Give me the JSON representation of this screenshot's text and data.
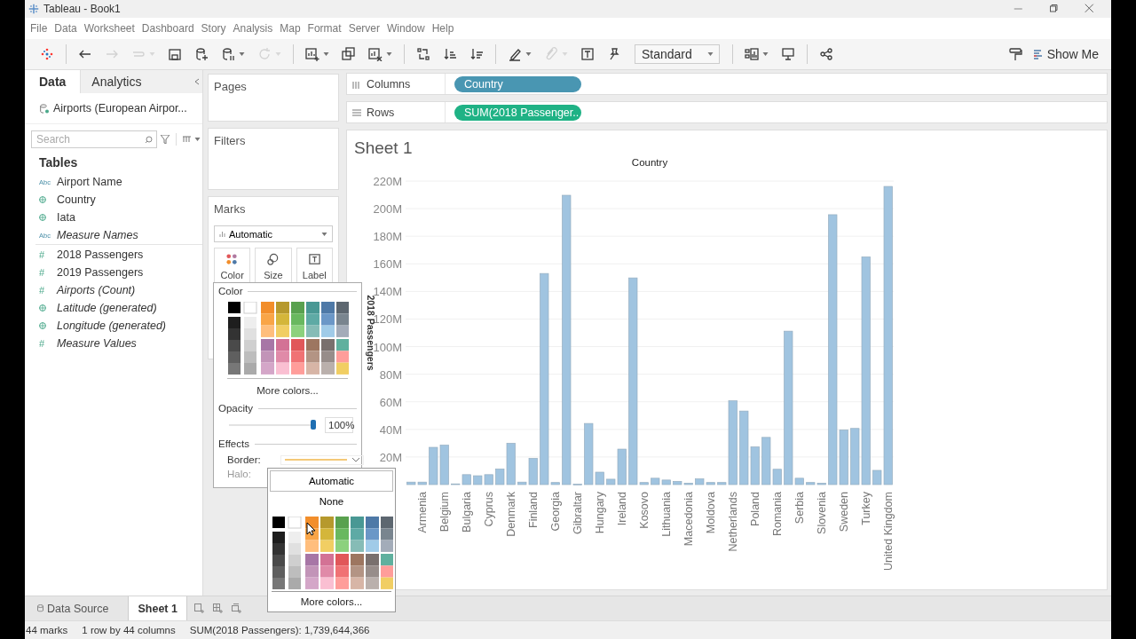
{
  "window": {
    "title": "Tableau - Book1"
  },
  "menu": [
    "File",
    "Data",
    "Worksheet",
    "Dashboard",
    "Story",
    "Analysis",
    "Map",
    "Format",
    "Server",
    "Window",
    "Help"
  ],
  "toolbar": {
    "items": [
      {
        "kind": "button",
        "disabled": false,
        "dropdown": false
      },
      {
        "kind": "separator"
      },
      {
        "kind": "button",
        "disabled": false,
        "dropdown": false
      },
      {
        "kind": "button",
        "disabled": true,
        "dropdown": false
      },
      {
        "kind": "button",
        "disabled": true,
        "dropdown": true
      },
      {
        "kind": "button",
        "disabled": false,
        "dropdown": false
      },
      {
        "kind": "button",
        "disabled": false,
        "dropdown": false
      },
      {
        "kind": "button",
        "disabled": false,
        "dropdown": true
      },
      {
        "kind": "button",
        "disabled": true,
        "dropdown": true
      },
      {
        "kind": "separator"
      },
      {
        "kind": "button",
        "disabled": false,
        "dropdown": true
      },
      {
        "kind": "button",
        "disabled": false,
        "dropdown": false
      },
      {
        "kind": "button",
        "disabled": false,
        "dropdown": true
      },
      {
        "kind": "separator"
      },
      {
        "kind": "button",
        "disabled": false,
        "dropdown": false
      },
      {
        "kind": "button",
        "disabled": false,
        "dropdown": false
      },
      {
        "kind": "button",
        "disabled": false,
        "dropdown": false
      },
      {
        "kind": "separator"
      },
      {
        "kind": "button",
        "disabled": false,
        "dropdown": true
      },
      {
        "kind": "button",
        "disabled": true,
        "dropdown": true
      },
      {
        "kind": "button",
        "disabled": false,
        "dropdown": false
      },
      {
        "kind": "button",
        "disabled": false,
        "dropdown": false
      },
      {
        "kind": "dropdown",
        "value": "Standard"
      },
      {
        "kind": "separator"
      },
      {
        "kind": "button",
        "disabled": false,
        "dropdown": true
      },
      {
        "kind": "button",
        "disabled": false,
        "dropdown": false
      },
      {
        "kind": "separator"
      },
      {
        "kind": "button",
        "disabled": false,
        "dropdown": false
      }
    ],
    "right_items": [
      {
        "kind": "button",
        "disabled": false,
        "dropdown": false
      },
      {
        "kind": "text_button",
        "label": "Show Me"
      }
    ]
  },
  "data_pane": {
    "tabs": [
      {
        "label": "Data",
        "selected": true
      },
      {
        "label": "Analytics",
        "selected": false
      }
    ],
    "data_source": "Airports (European Airpor...",
    "search": {
      "placeholder": "Search"
    },
    "section_title": "Tables",
    "fields": [
      {
        "kind": "text",
        "glyph": "Abc",
        "name": "Airport Name",
        "italic": false
      },
      {
        "kind": "geo",
        "name": "Country",
        "italic": false
      },
      {
        "kind": "geo",
        "name": "Iata",
        "italic": false
      },
      {
        "kind": "text",
        "glyph": "Abc",
        "name": "Measure Names",
        "italic": true
      },
      {
        "kind": "divider"
      },
      {
        "kind": "number",
        "glyph": "#",
        "name": "2018 Passengers",
        "italic": false
      },
      {
        "kind": "number",
        "glyph": "#",
        "name": "2019 Passengers",
        "italic": false
      },
      {
        "kind": "number",
        "glyph": "#",
        "name": "Airports (Count)",
        "italic": true
      },
      {
        "kind": "geo",
        "name": "Latitude (generated)",
        "italic": true
      },
      {
        "kind": "geo",
        "name": "Longitude (generated)",
        "italic": true
      },
      {
        "kind": "number",
        "glyph": "#",
        "name": "Measure Values",
        "italic": true
      }
    ]
  },
  "cards": {
    "pages": "Pages",
    "filters": "Filters",
    "marks": {
      "title": "Marks",
      "mark_type": "Automatic",
      "buttons": [
        {
          "label": "Color"
        },
        {
          "label": "Size"
        },
        {
          "label": "Label"
        }
      ]
    }
  },
  "shelves": [
    {
      "label": "Columns",
      "pill": "Country",
      "kind": "dimension"
    },
    {
      "label": "Rows",
      "pill": "SUM(2018 Passenger..",
      "kind": "measure"
    }
  ],
  "sheet": {
    "title": "Sheet 1",
    "chart_data": {
      "type": "bar",
      "grid": true,
      "title": "Country",
      "ylabel": "2018 Passengers",
      "categories": [
        null,
        "Armenia",
        null,
        "Belgium",
        null,
        "Bulgaria",
        null,
        "Cyprus",
        null,
        "Denmark",
        null,
        "Finland",
        null,
        "Georgia",
        null,
        "Gibraltar",
        null,
        "Hungary",
        null,
        "Ireland",
        null,
        "Kosovo",
        null,
        "Lithuania",
        null,
        "Macedonia",
        null,
        "Moldova",
        null,
        "Netherlands",
        null,
        "Poland",
        null,
        "Romania",
        null,
        "Serbia",
        null,
        "Slovenia",
        null,
        "Sweden",
        null,
        "Turkey",
        null,
        "United Kingdom"
      ],
      "values": [
        1.8,
        1.8,
        27,
        28.6,
        0.5,
        7.2,
        6.4,
        7.2,
        11.3,
        29.9,
        1.8,
        19,
        153,
        1.5,
        209.7,
        0.3,
        44.3,
        9,
        3.9,
        25.7,
        149.8,
        1.5,
        4.6,
        3.3,
        2.3,
        1,
        4.1,
        1.5,
        1.5,
        60.7,
        53.3,
        27.3,
        34.2,
        11.1,
        111.2,
        4.6,
        1.5,
        1,
        195.6,
        39.6,
        40.7,
        165,
        10.3,
        216.1
      ],
      "ylim": [
        0,
        220
      ],
      "yticks": [
        {
          "value": 20,
          "label": "20M"
        },
        {
          "value": 40,
          "label": "40M"
        },
        {
          "value": 60,
          "label": "60M"
        },
        {
          "value": 80,
          "label": "80M"
        },
        {
          "value": 100,
          "label": "100M"
        },
        {
          "value": 120,
          "label": "120M"
        },
        {
          "value": 140,
          "label": "140M"
        },
        {
          "value": 160,
          "label": "160M"
        },
        {
          "value": 180,
          "label": "180M"
        },
        {
          "value": 200,
          "label": "200M"
        },
        {
          "value": 220,
          "label": "220M"
        }
      ]
    }
  },
  "color_popup": {
    "title": "Color",
    "more_colors": "More colors...",
    "opacity_title": "Opacity",
    "opacity": {
      "level": 1.0,
      "reading": "100%"
    },
    "effects_title": "Effects",
    "border_label": "Border:",
    "halo": {
      "label": "Halo:",
      "disabled": true
    }
  },
  "border_dropdown": {
    "options": [
      "Automatic",
      "None"
    ],
    "more_colors": "More colors..."
  },
  "sheet_tabs": [
    {
      "label": "Data Source",
      "kind": "data_source",
      "selected": false
    },
    {
      "label": "Sheet 1",
      "kind": "sheet",
      "selected": true
    }
  ],
  "status_bar": [
    "44 marks",
    "1 row by 44 columns",
    "SUM(2018 Passengers): 1,739,644,366"
  ]
}
